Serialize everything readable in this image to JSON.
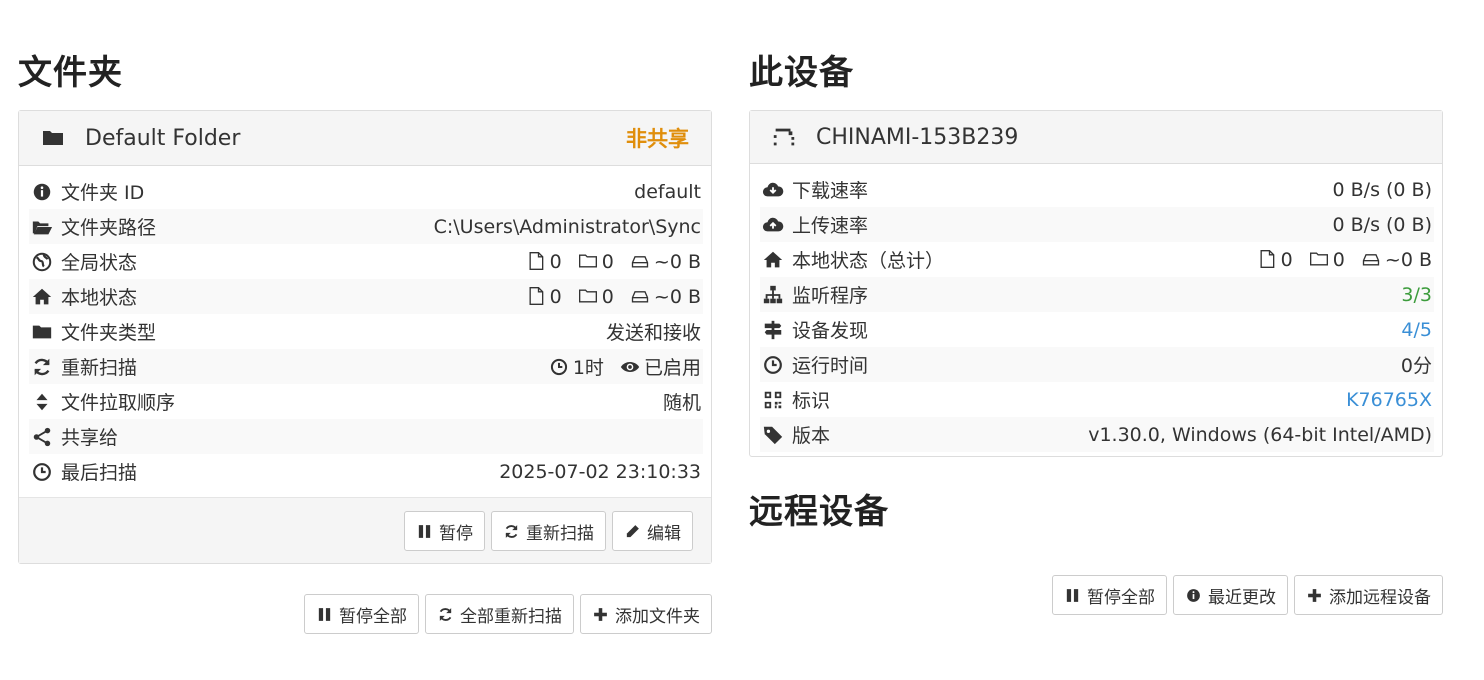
{
  "folders": {
    "title": "文件夹",
    "folder": {
      "name": "Default Folder",
      "share_status": "非共享",
      "rows": [
        {
          "label": "文件夹 ID",
          "value": "default"
        },
        {
          "label": "文件夹路径",
          "value": "C:\\Users\\Administrator\\Sync"
        },
        {
          "label": "全局状态",
          "files": "0",
          "dirs": "0",
          "size": "~0 B"
        },
        {
          "label": "本地状态",
          "files": "0",
          "dirs": "0",
          "size": "~0 B"
        },
        {
          "label": "文件夹类型",
          "value": "发送和接收"
        },
        {
          "label": "重新扫描",
          "interval": "1时",
          "watcher": "已启用"
        },
        {
          "label": "文件拉取顺序",
          "value": "随机"
        },
        {
          "label": "共享给",
          "value": ""
        },
        {
          "label": "最后扫描",
          "value": "2025-07-02 23:10:33"
        }
      ],
      "buttons": {
        "pause": "暂停",
        "rescan": "重新扫描",
        "edit": "编辑"
      }
    },
    "actions": {
      "pause_all": "暂停全部",
      "rescan_all": "全部重新扫描",
      "add_folder": "添加文件夹"
    }
  },
  "this_device": {
    "title": "此设备",
    "name": "CHINAMI-153B239",
    "rows": [
      {
        "label": "下载速率",
        "value": "0 B/s (0 B)"
      },
      {
        "label": "上传速率",
        "value": "0 B/s (0 B)"
      },
      {
        "label": "本地状态（总计）",
        "files": "0",
        "dirs": "0",
        "size": "~0 B"
      },
      {
        "label": "监听程序",
        "value": "3/3"
      },
      {
        "label": "设备发现",
        "value": "4/5"
      },
      {
        "label": "运行时间",
        "value": "0分"
      },
      {
        "label": "标识",
        "value": "K76765X"
      },
      {
        "label": "版本",
        "value": "v1.30.0, Windows (64-bit Intel/AMD)"
      }
    ]
  },
  "remote_devices": {
    "title": "远程设备",
    "actions": {
      "pause_all": "暂停全部",
      "recent_changes": "最近更改",
      "add_device": "添加远程设备"
    }
  },
  "colors": {
    "unshared": "#e08e0b",
    "ok_green": "#3c9c3c",
    "link_blue": "#3a8fd6"
  }
}
